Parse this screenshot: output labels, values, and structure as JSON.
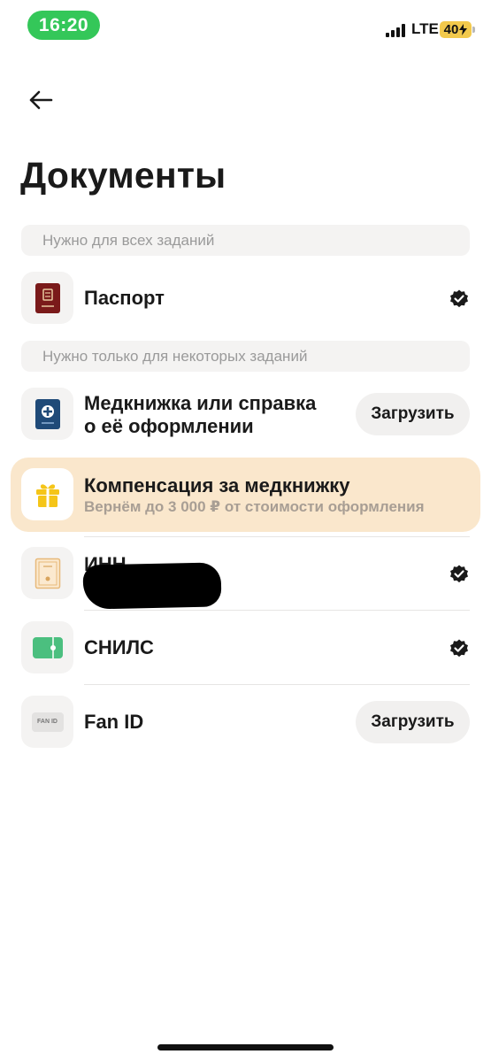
{
  "status_bar": {
    "time": "16:20",
    "network": "LTE",
    "battery": "40"
  },
  "header": {
    "back_icon": "arrow-left-icon",
    "title": "Документы"
  },
  "sections": {
    "required_all": "Нужно для всех заданий",
    "required_some": "Нужно только для некоторых заданий"
  },
  "documents": {
    "passport": {
      "title": "Паспорт",
      "icon": "passport-icon",
      "status": "verified"
    },
    "medbook": {
      "title_line1": "Медкнижка или справка",
      "title_line2": "о её оформлении",
      "icon": "medbook-icon",
      "action": "Загрузить"
    },
    "inn": {
      "title": "ИНН",
      "icon": "inn-certificate-icon",
      "status": "verified"
    },
    "snils": {
      "title": "СНИЛС",
      "icon": "snils-card-icon",
      "status": "verified"
    },
    "fanid": {
      "title": "Fan ID",
      "icon": "fan-id-icon",
      "icon_text": "FAN ID",
      "action": "Загрузить"
    }
  },
  "promo": {
    "title": "Компенсация за медкнижку",
    "subtitle": "Вернём до 3 000 ₽ от стоимости оформления",
    "icon": "gift-icon",
    "background": "#fae7cc"
  },
  "colors": {
    "time_pill": "#34c759",
    "battery": "#f2c94c",
    "section_bg": "#f4f3f2",
    "passport": "#7a1a1a",
    "medbook": "#1f4a78",
    "snils": "#4bbf7f",
    "gift": "#f5c518"
  }
}
